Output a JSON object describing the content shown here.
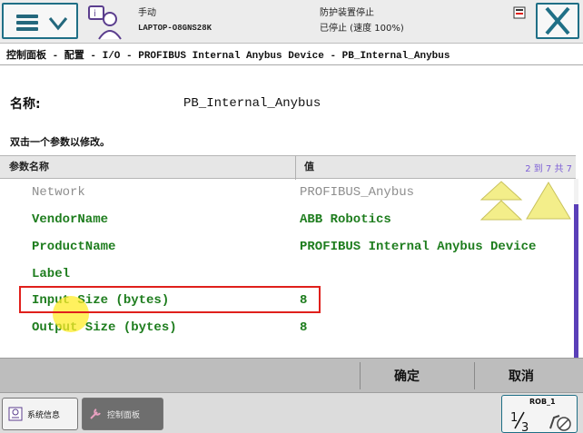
{
  "topbar": {
    "menu_icon": "hamburger-menu-icon",
    "quickset_icon": "robot-operator-icon",
    "mode": "手动",
    "controller": "LAPTOP-O8GNS28K",
    "safety_status": "防护装置停止",
    "run_status": "已停止 (速度 100%)",
    "close_icon": "close-x-icon"
  },
  "breadcrumb": "控制面板 - 配置 - I/O - PROFIBUS Internal Anybus Device - PB_Internal_Anybus",
  "name_label": "名称:",
  "name_value": "PB_Internal_Anybus",
  "hint": "双击一个参数以修改。",
  "table": {
    "col_param": "参数名称",
    "col_value": "值",
    "page_info": "2 到 7 共 7",
    "rows": [
      {
        "name": "Network",
        "value": "PROFIBUS_Anybus",
        "dim": true
      },
      {
        "name": "VendorName",
        "value": "ABB Robotics"
      },
      {
        "name": "ProductName",
        "value": "PROFIBUS Internal Anybus Device"
      },
      {
        "name": "Label",
        "value": ""
      },
      {
        "name": "Input Size (bytes)",
        "value": "8"
      },
      {
        "name": "Output Size (bytes)",
        "value": "8"
      }
    ]
  },
  "actions": {
    "ok": "确定",
    "cancel": "取消"
  },
  "taskbar": {
    "system_info": "系统信息",
    "control_panel": "控制面板",
    "rob_label": "ROB_1",
    "fraction": "1/3"
  },
  "colors": {
    "accent": "#1f6f86",
    "value_green": "#1e7d1e",
    "highlight_red": "#e0201c",
    "scroll_purple": "#5a3fb8",
    "arrow_yellow": "#f3ee8a"
  }
}
